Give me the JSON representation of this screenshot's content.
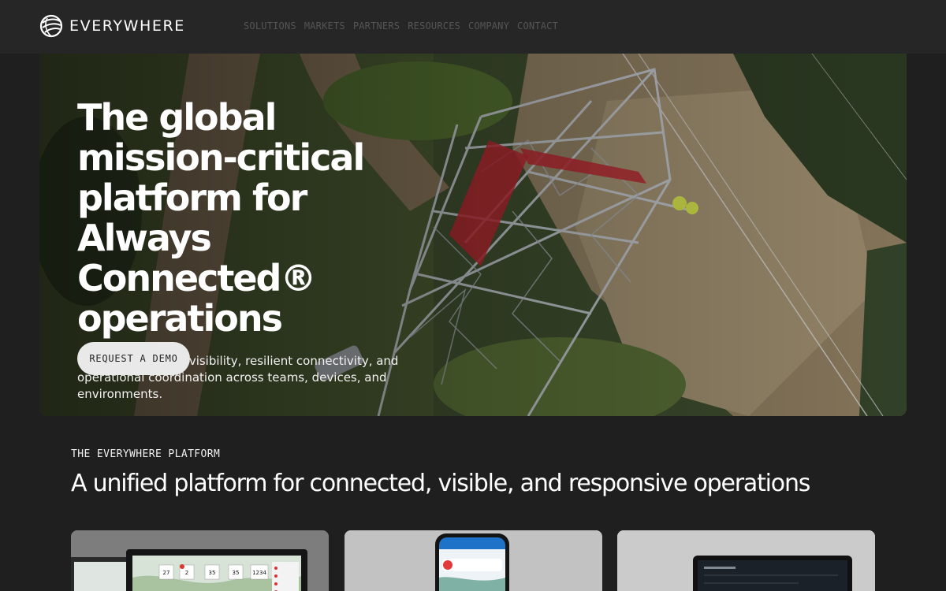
{
  "brand": {
    "name": "EVERYWHERE",
    "logo_icon": "globe-logo-icon"
  },
  "nav": {
    "items": [
      "SOLUTIONS",
      "MARKETS",
      "PARTNERS",
      "RESOURCES",
      "COMPANY",
      "CONTACT"
    ]
  },
  "hero": {
    "title": "The global mission-critical platform for Always Connected® operations",
    "subtitle": "Maintain real-time visibility, resilient connectivity, and operational coordination across teams, devices, and environments.",
    "cta_label": "REQUEST A DEMO",
    "image": "aerial-transmission-tower-photo"
  },
  "platform": {
    "eyebrow": "THE EVERYWHERE PLATFORM",
    "title": "A unified platform for connected, visible, and responsive operations",
    "cards": [
      {
        "image": "laptop-dashboard-photo",
        "stats": [
          "27",
          "2",
          "35",
          "35",
          "1234"
        ]
      },
      {
        "image": "phone-app-photo"
      },
      {
        "image": "tablet-device-photo"
      }
    ]
  },
  "colors": {
    "background": "#1f1f1f",
    "header": "#262626",
    "button_bg": "#e9e9e9",
    "nav_text": "#555555"
  }
}
